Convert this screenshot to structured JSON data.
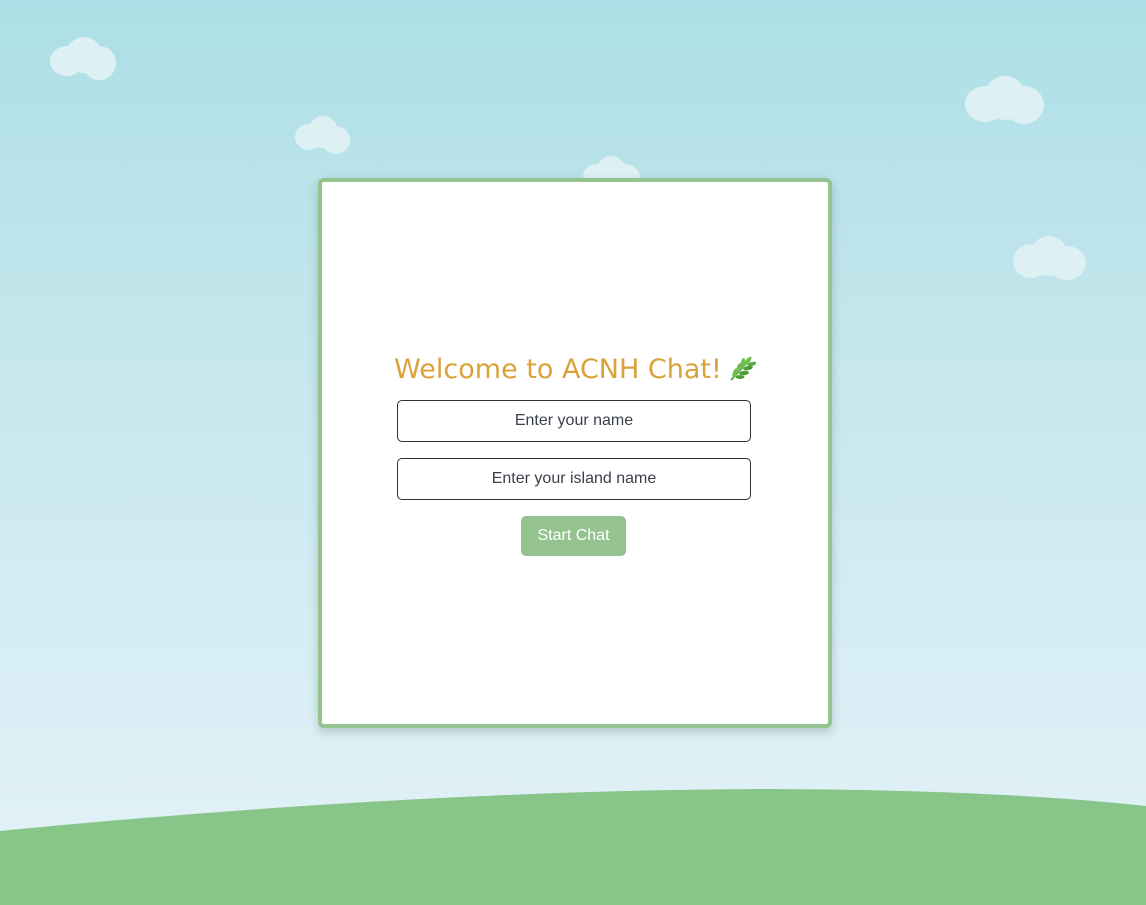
{
  "welcome": {
    "title": "Welcome to ACNH Chat!",
    "title_icon": "herb-leaf-icon"
  },
  "form": {
    "name_placeholder": "Enter your name",
    "name_value": "",
    "island_placeholder": "Enter your island name",
    "island_value": "",
    "start_label": "Start Chat"
  },
  "colors": {
    "sky_top": "#acdfe5",
    "sky_bottom": "#e3f3f8",
    "grass": "#88c589",
    "card_border": "#93c490",
    "title": "#d9a23a",
    "button": "#94c38f",
    "cloud": "#ddf0f3"
  }
}
